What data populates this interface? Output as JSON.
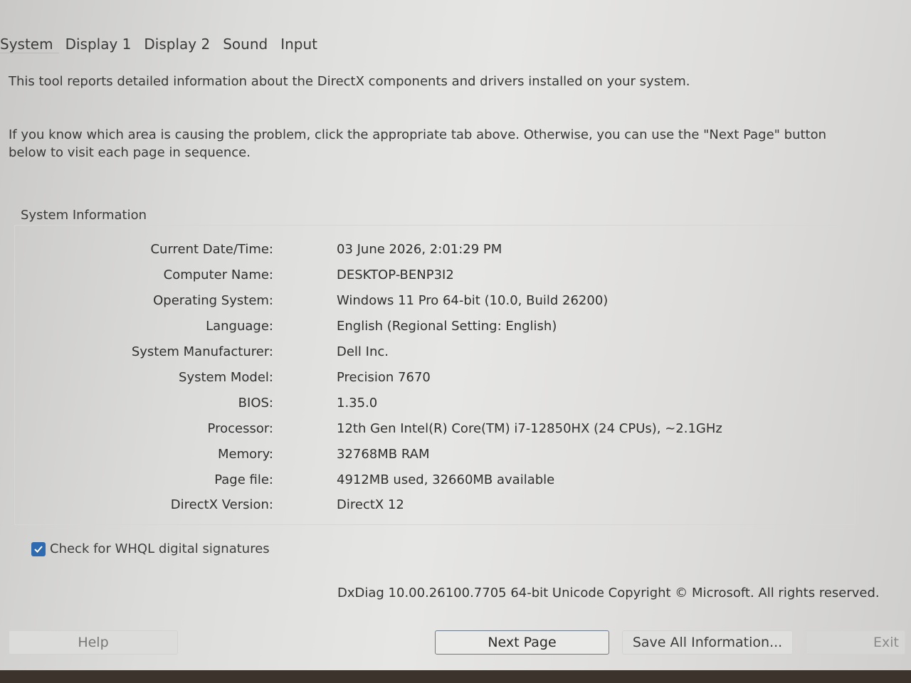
{
  "tabs": [
    {
      "label": "System"
    },
    {
      "label": "Display 1"
    },
    {
      "label": "Display 2"
    },
    {
      "label": "Sound"
    },
    {
      "label": "Input"
    }
  ],
  "intro": {
    "line1": "This tool reports detailed information about the DirectX components and drivers installed on your system.",
    "line2": "If you know which area is causing the problem, click the appropriate tab above.  Otherwise, you can use the \"Next Page\" button below to visit each page in sequence."
  },
  "system_info": {
    "title": "System Information",
    "rows": [
      {
        "label": "Current Date/Time:",
        "value": "03 June 2026, 2:01:29 PM"
      },
      {
        "label": "Computer Name:",
        "value": "DESKTOP-BENP3I2"
      },
      {
        "label": "Operating System:",
        "value": "Windows 11 Pro 64-bit (10.0, Build 26200)"
      },
      {
        "label": "Language:",
        "value": "English (Regional Setting: English)"
      },
      {
        "label": "System Manufacturer:",
        "value": "Dell Inc."
      },
      {
        "label": "System Model:",
        "value": "Precision 7670"
      },
      {
        "label": "BIOS:",
        "value": "1.35.0"
      },
      {
        "label": "Processor:",
        "value": "12th Gen Intel(R) Core(TM) i7-12850HX (24 CPUs), ~2.1GHz"
      },
      {
        "label": "Memory:",
        "value": "32768MB RAM"
      },
      {
        "label": "Page file:",
        "value": "4912MB used, 32660MB available"
      },
      {
        "label": "DirectX Version:",
        "value": "DirectX 12"
      }
    ]
  },
  "whql": {
    "label": "Check for WHQL digital signatures",
    "checked": true
  },
  "footer": {
    "version_text": "DxDiag 10.00.26100.7705 64-bit Unicode  Copyright © Microsoft. All rights reserved."
  },
  "buttons": {
    "help": "Help",
    "next_page": "Next Page",
    "save_all": "Save All Information...",
    "exit": "Exit"
  },
  "colors": {
    "checkbox_accent": "#2e6ab0",
    "default_button_border": "#6c7a8c"
  }
}
